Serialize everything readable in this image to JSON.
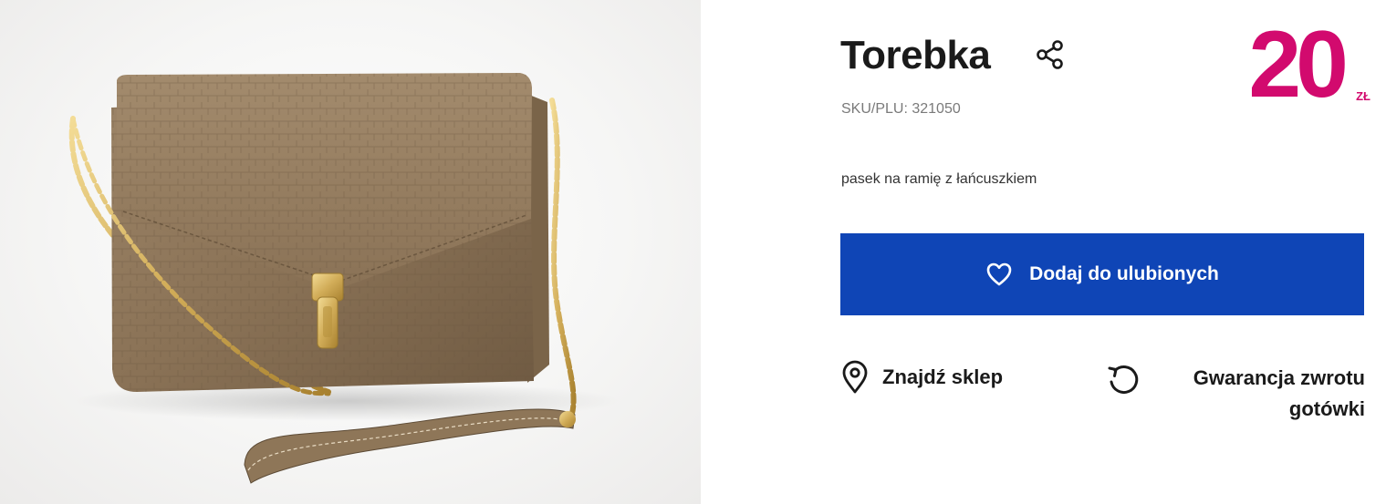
{
  "product": {
    "title": "Torebka",
    "sku": "SKU/PLU: 321050",
    "description": "pasek na ramię z łańcuszkiem",
    "image_alt": "brown crossbody bag with gold chain",
    "price": {
      "value": "20",
      "currency": "ZŁ"
    }
  },
  "actions": {
    "favorite_label": "Dodaj do ulubionych",
    "find_store_label": "Znajdź sklep",
    "refund_label": "Gwarancja zwrotu gotówki"
  },
  "icons": {
    "share": "share-icon",
    "favorite": "heart-icon",
    "store": "map-pin-icon",
    "refund": "refresh-icon"
  },
  "colors": {
    "price": "#d20a6e",
    "button": "#0f45b6",
    "text": "#1a1a1a"
  }
}
